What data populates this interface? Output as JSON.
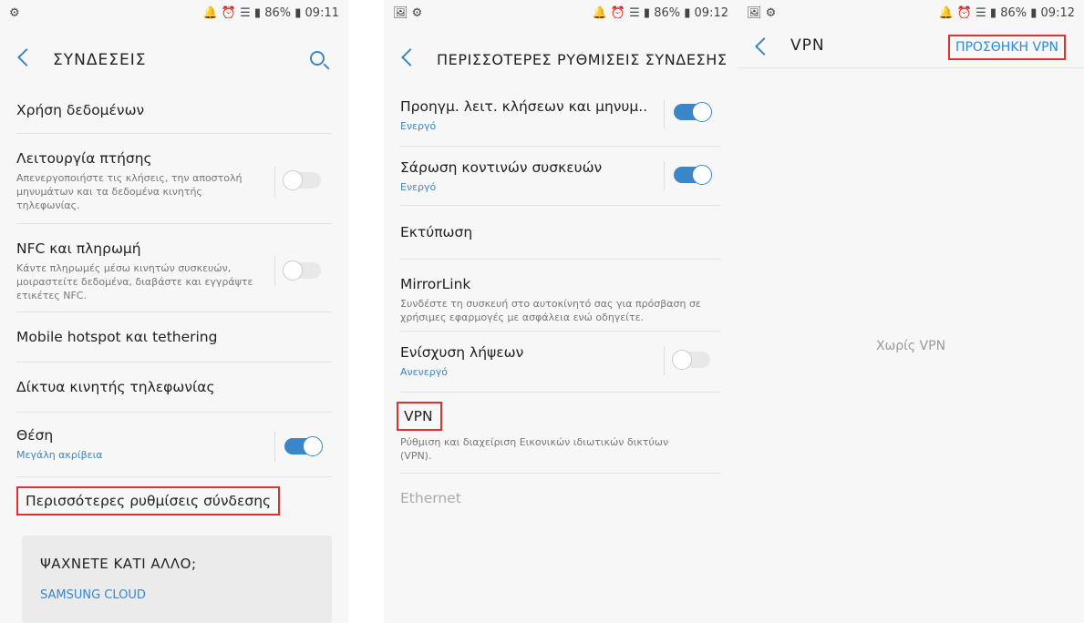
{
  "screens": [
    {
      "status": {
        "left": "⚙",
        "right": "🔔 ⏰ ☰ ▮ 86% ▮ 09:11"
      },
      "title": "ΣΥΝΔΕΣΕΙΣ",
      "items": [
        {
          "label": "Χρήση δεδομένων"
        },
        {
          "label": "Λειτουργία πτήσης",
          "desc": "Απενεργοποιήστε τις κλήσεις, την αποστολή μηνυμάτων και τα δεδομένα κινητής τηλεφωνίας.",
          "toggle": false
        },
        {
          "label": "NFC και πληρωμή",
          "desc": "Κάντε πληρωμές μέσω κινητών συσκευών, μοιραστείτε δεδομένα, διαβάστε και εγγράψτε ετικέτες NFC.",
          "toggle": false
        },
        {
          "label": "Mobile hotspot και tethering"
        },
        {
          "label": "Δίκτυα κινητής τηλεφωνίας"
        },
        {
          "label": "Θέση",
          "sub": "Μεγάλη ακρίβεια",
          "toggle": true
        },
        {
          "label": "Περισσότερες ρυθμίσεις σύνδεσης"
        }
      ],
      "card": {
        "heading": "ΨΑΧΝΕΤΕ ΚΑΤΙ ΑΛΛΟ;",
        "link": "SAMSUNG CLOUD"
      }
    },
    {
      "status": {
        "left": "🖼 ⚙",
        "right": "🔔 ⏰ ☰ ▮ 86% ▮ 09:12"
      },
      "title": "ΠΕΡΙΣΣΟΤΕΡΕΣ ΡΥΘΜΙΣΕΙΣ ΣΥΝΔΕΣΗΣ",
      "items": [
        {
          "label": "Προηγμ. λειτ. κλήσεων και μηνυμ..",
          "sub": "Ενεργό",
          "toggle": true
        },
        {
          "label": "Σάρωση κοντινών συσκευών",
          "sub": "Ενεργό",
          "toggle": true
        },
        {
          "label": "Εκτύπωση"
        },
        {
          "label": "MirrorLink",
          "desc": "Συνδέστε τη συσκευή στο αυτοκίνητό σας για πρόσβαση σε χρήσιμες εφαρμογές με ασφάλεια ενώ οδηγείτε."
        },
        {
          "label": "Ενίσχυση λήψεων",
          "sub": "Ανενεργό",
          "toggle": false
        },
        {
          "label": "VPN",
          "desc": "Ρύθμιση και διαχείριση Εικονικών ιδιωτικών δικτύων (VPN)."
        },
        {
          "label": "Ethernet"
        }
      ]
    },
    {
      "status": {
        "left": "🖼 ⚙",
        "right": "🔔 ⏰ ☰ ▮ 86% ▮ 09:12"
      },
      "title": "VPN",
      "action": "ΠΡΟΣΘΗΚΗ VPN",
      "empty": "Χωρίς VPN"
    }
  ]
}
